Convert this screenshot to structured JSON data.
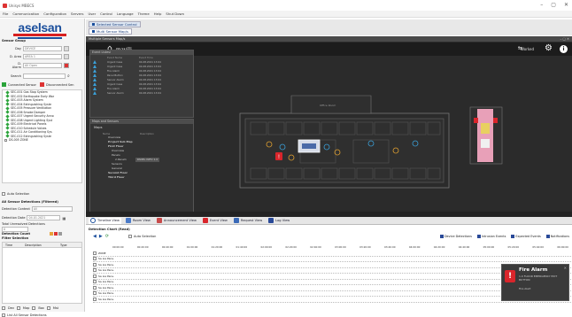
{
  "window": {
    "title": "Unisys MBECS",
    "controls": [
      "–",
      "▢",
      "✕"
    ]
  },
  "menubar": [
    "File",
    "Communication",
    "Configuration",
    "Servers",
    "User",
    "Control",
    "Language",
    "Theme",
    "Help",
    "Shut Down"
  ],
  "left": {
    "logo_text": "aselsan",
    "sensor_group_label": "Sensor Group",
    "day_label": "Day",
    "day_value": "DEVICE",
    "area_label": "D. Area",
    "area_value": "AREA 1",
    "alarm_label": "D. Alarm",
    "alarm_value": "All Open",
    "search_label": "Search",
    "legend_connected": "Connected Sensor",
    "legend_disconnected": "Disconnected Sen",
    "tree_items": [
      "SEC-001 Gas Stop System",
      "SEC-002 Earthquake Early War",
      "SEC-003 Alarm System",
      "SEC-004 Extinguishing Syste",
      "SEC-005 Pressure Ventilation",
      "SEC-006 Smoke Damper",
      "SEC-007 Urgent Security Anno",
      "SEC-008 Urgent Lighting Syst",
      "SEC-009 Electrical Panels",
      "SEC-010 Schedule Valves",
      "SEC-011 Air Conditioning Sys",
      "SEC-012 Extinguishing Syste",
      "DS-005 ZONE"
    ],
    "auto_selection": "Auto Selection",
    "all_sensor_detections": "All Sensor Detections (Filtered)",
    "detection_context_label": "Detection Context",
    "detection_context_value": "All",
    "detection_date_label": "Detection Date",
    "detection_date_value": "04.01.2021",
    "total_unresolved_label": "Total Unresolved Detections",
    "total_unresolved_value": "0",
    "detection_count_label": "Detection Count",
    "filter_selection_label": "Filter Selection",
    "grid_cols": [
      "Time",
      "Description",
      "Type"
    ],
    "bottom_checks": [
      "Dev",
      "Map",
      "Box",
      "Mst"
    ],
    "list_all": "List All Sensor Detections"
  },
  "tabs": {
    "tab1": "Selected Sensor Control",
    "tab2": "Multi Sensor Map/s"
  },
  "main": {
    "subheader": "Multiple Sensors Map/s",
    "map_title": "mavili",
    "mode_label": "Worked",
    "event_pane_title": "Event Listesi",
    "event_cols": [
      "",
      "Event Name",
      "Event Time"
    ],
    "events": [
      {
        "name": "Urgent Case",
        "time": "04.08.2021 13:04"
      },
      {
        "name": "Urgent Case",
        "time": "04.08.2021 13:04"
      },
      {
        "name": "Fire Alarm",
        "time": "04.08.2021 13:04"
      },
      {
        "name": "Panel Button",
        "time": "04.08.2021 13:04"
      },
      {
        "name": "Sensor Alarm",
        "time": "04.08.2021 13:04"
      },
      {
        "name": "Urgent Case",
        "time": "04.08.2021 13:04"
      },
      {
        "name": "Fire Alarm",
        "time": "04.08.2021 13:04"
      },
      {
        "name": "Sensor Alarm",
        "time": "04.08.2021 13:04"
      }
    ],
    "map_pane_title": "Maps and Sensors",
    "maps_label": "Maps",
    "map_cols": [
      "Name",
      "Description"
    ],
    "map_tree": [
      "Overview",
      "Project Sub Map",
      "First Floor",
      "Overview",
      "Panels",
      "2.Panel1",
      "Sensors",
      "General",
      "Second Floor",
      "Third Floor"
    ],
    "map_tree_desc": "PANEL INFO 1.0",
    "floor_zone": "Office Room"
  },
  "timeline": {
    "tabs": [
      "Timeline View",
      "Room View",
      "Announcement View",
      "Event View",
      "Request View",
      "Log View"
    ],
    "detection_chart_label": "Detection Chart (Read)",
    "auto_selection": "Auto Selection",
    "legend": [
      "Device Detections",
      "Intrusion Events",
      "Expected Events",
      "Notifications"
    ],
    "times": [
      "00:00:00",
      "00:20:00",
      "00:40:00",
      "01:00:00",
      "01:20:00",
      "01:40:00",
      "02:00:00",
      "02:20:00",
      "02:40:00",
      "03:00:00",
      "03:20:00",
      "03:40:00",
      "04:00:00",
      "04:20:00",
      "04:40:00",
      "05:00:00",
      "05:20:00",
      "05:40:00",
      "06:00:00"
    ],
    "rows": [
      "ZONE",
      "Sa Lia Pans...",
      "Sa Lia Pans...",
      "Sa Lia Pans...",
      "Sa Lia Pans...",
      "Sa Lia Pans...",
      "Sa Lia Pans...",
      "Sa Lia Pans...",
      "Sa Lia Pans..."
    ]
  },
  "alarm": {
    "title": "Fire Alarm",
    "subtitle": "1.0 FLOOR EMERGENCY EXIT BUTTON",
    "detail": "Fire Alert",
    "close": "✕"
  },
  "colors": {
    "brand_blue": "#1a4e9c",
    "brand_red": "#d72020",
    "alarm_red": "#d9252b",
    "accent_green": "#2aa33a"
  }
}
